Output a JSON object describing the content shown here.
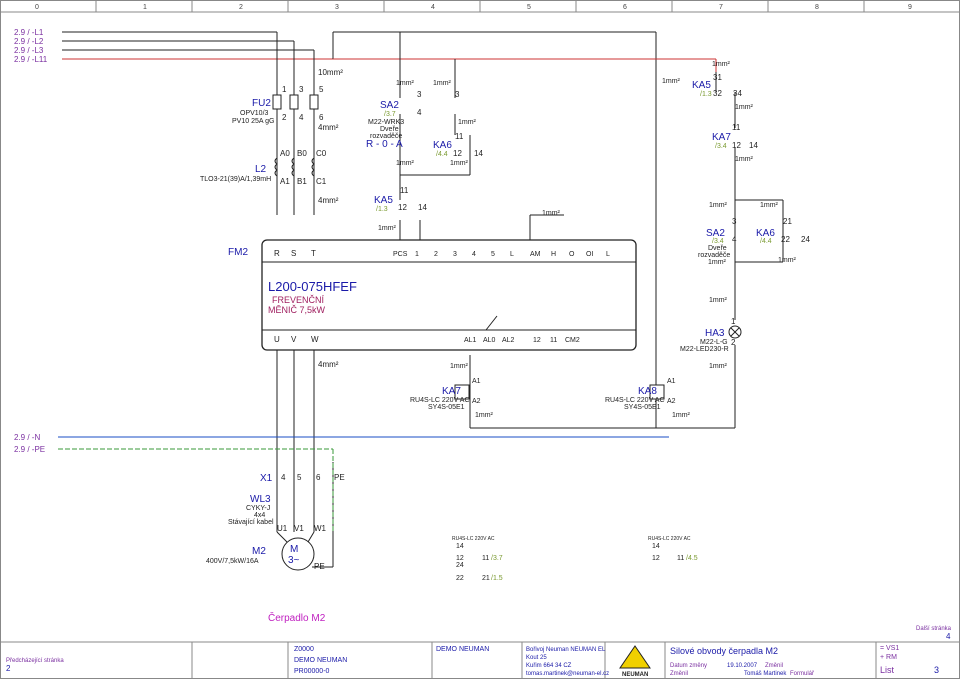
{
  "ruler": [
    "0",
    "1",
    "2",
    "3",
    "4",
    "5",
    "6",
    "7",
    "8",
    "9"
  ],
  "phases": [
    "2.9 / -L1",
    "2.9 / -L2",
    "2.9 / -L3",
    "2.9 / -L11"
  ],
  "phases_bottom": [
    "2.9 / -N",
    "2.9 / -PE"
  ],
  "fu2": {
    "tag": "FU2",
    "line1": "OPV10/3",
    "line2": "PV10 25A gG",
    "terms_top": [
      "1",
      "3",
      "5"
    ],
    "terms_bot": [
      "2",
      "4",
      "6"
    ]
  },
  "l2": {
    "tag": "L2",
    "desc": "TLO3-21(39)A/1,39mH",
    "t_top": [
      "A0",
      "B0",
      "C0"
    ],
    "t_bot": [
      "A1",
      "B1",
      "C1"
    ]
  },
  "fm2": {
    "tag": "FM2",
    "terms": [
      "R",
      "S",
      "T"
    ],
    "ctrl": [
      "PCS",
      "1",
      "2",
      "3",
      "4",
      "5",
      "L",
      "AM",
      "H",
      "O",
      "OI",
      "L"
    ],
    "name": "L200-075HFEF",
    "desc1": "FREVENČNÍ",
    "desc2": "MĚNIČ 7,5kW",
    "out": [
      "U",
      "V",
      "W"
    ],
    "relay": [
      "AL1",
      "AL0",
      "AL2"
    ],
    "out2": [
      "12",
      "11",
      "CM2"
    ]
  },
  "wires": {
    "w10": "10mm²",
    "w4": "4mm²",
    "w1": "1mm²"
  },
  "sa2": {
    "tag": "SA2",
    "ref": "/3.7",
    "type": "M22-WRK3",
    "d1": "Dveře",
    "d2": "rozvaděče",
    "mode": "R - 0 - A",
    "c3": "3",
    "c4": "4"
  },
  "ka5": {
    "tag": "KA5",
    "ref": "/1.3",
    "c11": "11",
    "c12": "12",
    "c14": "14"
  },
  "ka6": {
    "tag": "KA6",
    "ref": "/4.4",
    "c11": "11",
    "c12": "12",
    "c14": "14"
  },
  "ka5r": {
    "tag": "KA5",
    "ref": "/1.3",
    "c31": "31",
    "c32": "32",
    "c34": "34"
  },
  "ka7r": {
    "tag": "KA7",
    "ref": "/3.4",
    "c11": "11",
    "c12": "12",
    "c14": "14"
  },
  "sa2r": {
    "tag": "SA2",
    "ref": "/3.4",
    "d1": "Dveře",
    "d2": "rozvaděče",
    "c3": "3",
    "c4": "4"
  },
  "ka6r": {
    "tag": "KA6",
    "ref": "/4.4",
    "c21": "21",
    "c22": "22",
    "c24": "24"
  },
  "ha3": {
    "tag": "HA3",
    "type1": "M22-L-G",
    "type2": "M22-LED230-R",
    "c1": "1",
    "c2": "2"
  },
  "ka7": {
    "tag": "KA7",
    "type1": "RU4S-LC 220V AC",
    "type2": "SY4S-05E1",
    "a1": "A1",
    "a2": "A2"
  },
  "ka8": {
    "tag": "KA8",
    "type1": "RU4S-LC 220V AC",
    "type2": "SY4S-05E1",
    "a1": "A1",
    "a2": "A2"
  },
  "x1": {
    "tag": "X1",
    "terms": [
      "4",
      "5",
      "6",
      "PE"
    ]
  },
  "wl3": {
    "tag": "WL3",
    "l1": "CYKY-J",
    "l2": "4x4",
    "l3": "Stávající kabel"
  },
  "m2": {
    "tag": "M2",
    "desc": "400V/7,5kW/16A",
    "terms": [
      "U1",
      "V1",
      "W1"
    ],
    "sym": "M",
    "sym2": "3~",
    "pe": "PE"
  },
  "xref1": {
    "title": "RU4S-LC 220V AC",
    "r1": "14",
    "r2a": "12",
    "r2b": "11",
    "r2ref": "/3.7",
    "r3": "24",
    "r4a": "22",
    "r4b": "21",
    "r4ref": "/1.5"
  },
  "xref2": {
    "title": "RU4S-LC 220V AC",
    "r1": "14",
    "r2a": "12",
    "r2b": "11",
    "r2ref": "/4.5"
  },
  "footer": {
    "title": "Čerpadlo M2",
    "prev_label": "Předcházející stránka",
    "prev": "2",
    "c1a": "Z0000",
    "c1b": "DEMO NEUMAN",
    "c1c": "PR00000-0",
    "c2": "DEMO NEUMAN",
    "addr1": "Bořivoj Neuman NEUMAN EL",
    "addr2": "Kout 25",
    "addr3": "Kuřim 664 34 CZ",
    "addr4": "tomas.martinek@neuman-el.cz",
    "logo": "NEUMAN",
    "sheet_title": "Silové obvody čerpadla M2",
    "date_label": "Datum změny",
    "date": "19.10.2007",
    "change": "Změnil",
    "author": "Tomáš Martinek",
    "change2": "Změnil",
    "formular": "Formulář",
    "vs": "= VS1",
    "rm": "+ RM",
    "list": "List",
    "page": "3",
    "next_label": "Další stránka",
    "next": "4"
  }
}
